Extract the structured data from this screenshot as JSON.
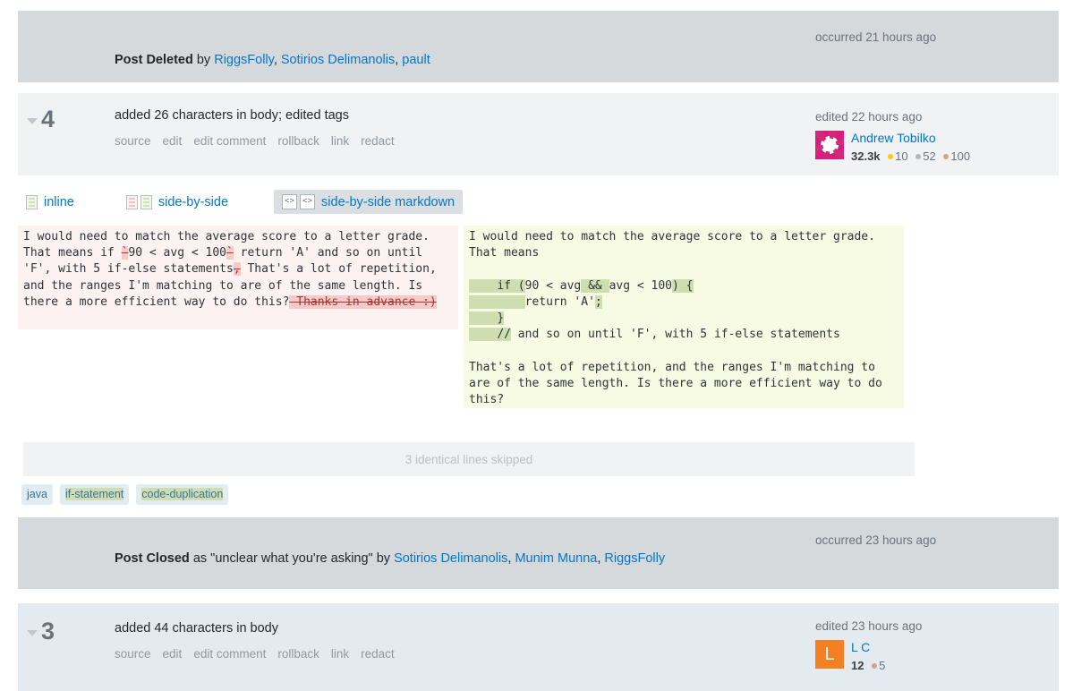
{
  "theme": {
    "link_color": "#0077cc",
    "grey_row_bg": "#d6d9dc",
    "light_row_bg": "#f1f2f3",
    "blue_row_bg": "#e3ebf1",
    "deleted_bg": "#f7c9c9",
    "inserted_bg": "#cfdeb0",
    "pane_left_bg": "#fdf2f2",
    "pane_right_bg": "#f7fbe4",
    "avatar_orange": "#f48024",
    "identicon_pink": "#d81b7d"
  },
  "events": [
    {
      "type": "post-deleted",
      "label_bold": "Post Deleted",
      "label_rest": " by ",
      "users": [
        "RiggsFolly",
        "Sotirios Delimanolis",
        "pault"
      ],
      "when": "occurred 21 hours ago"
    },
    {
      "type": "revision",
      "revision_number": "4",
      "title": "added 26 characters in body; edited tags",
      "actions": [
        "source",
        "edit",
        "edit comment",
        "rollback",
        "link",
        "redact"
      ],
      "when": "edited 22 hours ago",
      "user": {
        "name": "Andrew Tobilko",
        "reputation": "32.3k",
        "avatar_type": "identicon",
        "badges": [
          {
            "class": "gold",
            "count": "10"
          },
          {
            "class": "silver",
            "count": "52"
          },
          {
            "class": "bronze",
            "count": "100"
          }
        ]
      }
    },
    {
      "type": "post-closed",
      "label_bold": "Post Closed",
      "label_rest": " as \"unclear what you're asking\" by ",
      "users": [
        "Sotirios Delimanolis",
        "Munim Munna",
        "RiggsFolly"
      ],
      "when": "occurred 23 hours ago"
    },
    {
      "type": "revision",
      "revision_number": "3",
      "title": "added 44 characters in body",
      "actions": [
        "source",
        "edit",
        "edit comment",
        "rollback",
        "link",
        "redact"
      ],
      "when": "edited 23 hours ago",
      "user": {
        "name": "L C",
        "reputation": "12",
        "avatar_type": "letter",
        "avatar_letter": "L",
        "badges": [
          {
            "class": "bronze",
            "count": "5"
          }
        ]
      }
    }
  ],
  "diff_tabs": [
    {
      "id": "inline",
      "label": "inline",
      "icon": "document-lines-icon",
      "active": false
    },
    {
      "id": "side-by-side",
      "label": "side-by-side",
      "icon": "two-documents-icon",
      "active": false
    },
    {
      "id": "side-by-side-markdown",
      "label": "side-by-side markdown",
      "icon": "two-code-documents-icon",
      "active": true
    }
  ],
  "diff": {
    "left": {
      "line1": "I would need to match the average score to a letter grade.",
      "line2a": "That means if ",
      "del1": "`",
      "line2b": "90 < avg < 100",
      "del2": "`",
      "line2c": " return 'A' and so on until",
      "line3a": "'F', with 5 if-else statements",
      "del3": ",",
      "line3b": " That's a lot of repetition,",
      "line4": "and the ranges I'm matching to are of the same length. Is",
      "line5a": "there a more efficient way to do this?",
      "del4": " Thanks in advance :)"
    },
    "right": {
      "line1": "I would need to match the average score to a letter grade.",
      "line2": "That means",
      "blank1": "",
      "code1_ins_indent": "    ",
      "code1_a": "if ",
      "code1_ins_paren": "(",
      "code1_b": "90 < avg",
      "code1_ins_and": " && ",
      "code1_c": "avg < 100",
      "code1_ins_close": ") {",
      "code2_ins_indent": "        ",
      "code2_a": "return 'A'",
      "code2_ins_semi": ";",
      "code3_ins": "    }",
      "code4_ins": "    //",
      "code4_rest": " and so on until 'F', with 5 if-else statements",
      "blank2": "",
      "tail1": "That's a lot of repetition, and the ranges I'm matching to",
      "tail2": "are of the same length. Is there a more efficient way to do",
      "tail3": "this?"
    },
    "skipped_label": "3 identical lines skipped"
  },
  "tags": [
    {
      "name": "java",
      "highlighted": false
    },
    {
      "name": "if-statement",
      "highlighted": true
    },
    {
      "name": "code-duplication",
      "highlighted": true
    }
  ]
}
